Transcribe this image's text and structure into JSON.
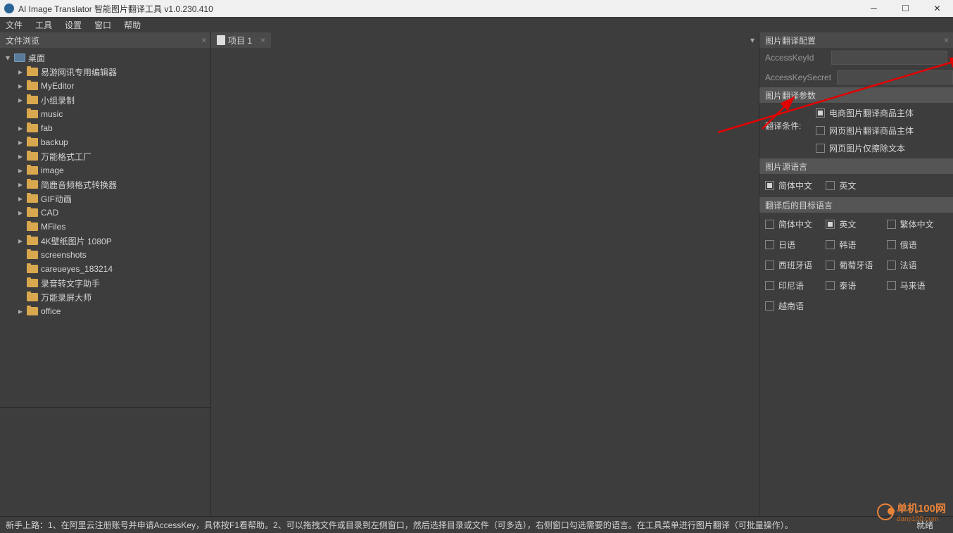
{
  "titlebar": {
    "title": "AI Image Translator 智能图片翻译工具 v1.0.230.410"
  },
  "menu": {
    "file": "文件",
    "tools": "工具",
    "settings": "设置",
    "window": "窗口",
    "help": "帮助"
  },
  "left": {
    "header": "文件浏览",
    "tree": [
      {
        "label": "桌面",
        "depth": 0,
        "expanded": true,
        "icon": "desktop"
      },
      {
        "label": "易游网讯专用编辑器",
        "depth": 1,
        "expandable": true
      },
      {
        "label": "MyEditor",
        "depth": 1,
        "expandable": true
      },
      {
        "label": "小组录制",
        "depth": 1,
        "expandable": true
      },
      {
        "label": "music",
        "depth": 1
      },
      {
        "label": "fab",
        "depth": 1,
        "expandable": true
      },
      {
        "label": "backup",
        "depth": 1,
        "expandable": true
      },
      {
        "label": "万能格式工厂",
        "depth": 1,
        "expandable": true
      },
      {
        "label": "image",
        "depth": 1,
        "expandable": true
      },
      {
        "label": "简鹿音频格式转换器",
        "depth": 1,
        "expandable": true
      },
      {
        "label": "GIF动画",
        "depth": 1,
        "expandable": true
      },
      {
        "label": "CAD",
        "depth": 1,
        "expandable": true
      },
      {
        "label": "MFiles",
        "depth": 1
      },
      {
        "label": "4K壁纸图片 1080P",
        "depth": 1,
        "expandable": true
      },
      {
        "label": "screenshots",
        "depth": 1
      },
      {
        "label": "careueyes_183214",
        "depth": 1
      },
      {
        "label": "录音转文字助手",
        "depth": 1
      },
      {
        "label": "万能录屏大师",
        "depth": 1
      },
      {
        "label": "office",
        "depth": 1,
        "expandable": true
      }
    ]
  },
  "center": {
    "tab_label": "项目 1"
  },
  "right": {
    "header": "图片翻译配置",
    "access_key_id_label": "AccessKeyId",
    "access_key_id_value": "",
    "access_key_secret_label": "AccessKeySecret",
    "access_key_secret_value": "",
    "params_header": "图片翻译参数",
    "cond_label": "翻译条件:",
    "cond_opts": [
      {
        "label": "电商图片翻译商品主体",
        "checked": true
      },
      {
        "label": "网页图片翻译商品主体",
        "checked": false
      },
      {
        "label": "网页图片仅擦除文本",
        "checked": false
      }
    ],
    "src_header": "图片源语言",
    "src_opts": [
      {
        "label": "简体中文",
        "checked": true
      },
      {
        "label": "英文",
        "checked": false
      }
    ],
    "tgt_header": "翻译后的目标语言",
    "tgt_opts": [
      {
        "label": "简体中文",
        "checked": false
      },
      {
        "label": "英文",
        "checked": true
      },
      {
        "label": "繁体中文",
        "checked": false
      },
      {
        "label": "日语",
        "checked": false
      },
      {
        "label": "韩语",
        "checked": false
      },
      {
        "label": "俄语",
        "checked": false
      },
      {
        "label": "西班牙语",
        "checked": false
      },
      {
        "label": "葡萄牙语",
        "checked": false
      },
      {
        "label": "法语",
        "checked": false
      },
      {
        "label": "印尼语",
        "checked": false
      },
      {
        "label": "泰语",
        "checked": false
      },
      {
        "label": "马来语",
        "checked": false
      },
      {
        "label": "越南语",
        "checked": false
      }
    ]
  },
  "statusbar": {
    "text": "新手上路：1、在阿里云注册账号并申请AccessKey，具体按F1看帮助。2、可以拖拽文件或目录到左侧窗口，然后选择目录或文件（可多选），右侧窗口勾选需要的语言。在工具菜单进行图片翻译（可批量操作）。",
    "ready": "就绪"
  },
  "watermark": {
    "text": "单机100网",
    "sub": "danji100.com"
  }
}
